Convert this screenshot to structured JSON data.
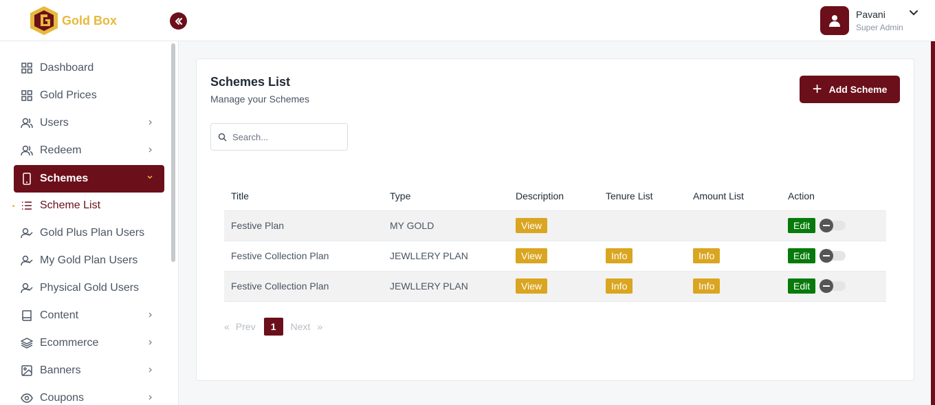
{
  "header": {
    "brand": "Gold Box",
    "collapse_icon": "double-chevron-left-icon",
    "user": {
      "name": "Pavani",
      "role": "Super Admin"
    }
  },
  "sidebar": {
    "items": [
      {
        "label": "Dashboard",
        "icon": "grid-icon"
      },
      {
        "label": "Gold Prices",
        "icon": "grid-icon"
      },
      {
        "label": "Users",
        "icon": "users-icon"
      },
      {
        "label": "Redeem",
        "icon": "users-icon"
      },
      {
        "label": "Schemes",
        "icon": "tablet-icon"
      },
      {
        "label": "Scheme List",
        "icon": "list-icon"
      },
      {
        "label": "Gold Plus Plan Users",
        "icon": "user-check-icon"
      },
      {
        "label": "My Gold Plan Users",
        "icon": "user-check-icon"
      },
      {
        "label": "Physical Gold Users",
        "icon": "user-check-icon"
      },
      {
        "label": "Content",
        "icon": "book-icon"
      },
      {
        "label": "Ecommerce",
        "icon": "layers-icon"
      },
      {
        "label": "Banners",
        "icon": "image-icon"
      },
      {
        "label": "Coupons",
        "icon": "eye-icon"
      }
    ]
  },
  "main": {
    "title": "Schemes List",
    "subtitle": "Manage your Schemes",
    "add_button": "Add Scheme",
    "search": {
      "placeholder": "Search...",
      "value": ""
    },
    "table": {
      "columns": [
        "Title",
        "Type",
        "Description",
        "Tenure List",
        "Amount List",
        "Action"
      ],
      "rows": [
        {
          "title": "Festive Plan",
          "type": "MY GOLD",
          "description": "View",
          "tenure": "",
          "amount": "",
          "edit": "Edit"
        },
        {
          "title": "Festive Collection Plan",
          "type": "JEWLLERY PLAN",
          "description": "View",
          "tenure": "Info",
          "amount": "Info",
          "edit": "Edit"
        },
        {
          "title": "Festive Collection Plan",
          "type": "JEWLLERY PLAN",
          "description": "View",
          "tenure": "Info",
          "amount": "Info",
          "edit": "Edit"
        }
      ]
    },
    "pagination": {
      "prev": "Prev",
      "next": "Next",
      "current": "1",
      "first_glyph": "«",
      "last_glyph": "»"
    }
  },
  "colors": {
    "brand": "#6b0f1a",
    "gold": "#daa520",
    "edit_green": "#067a0a"
  }
}
